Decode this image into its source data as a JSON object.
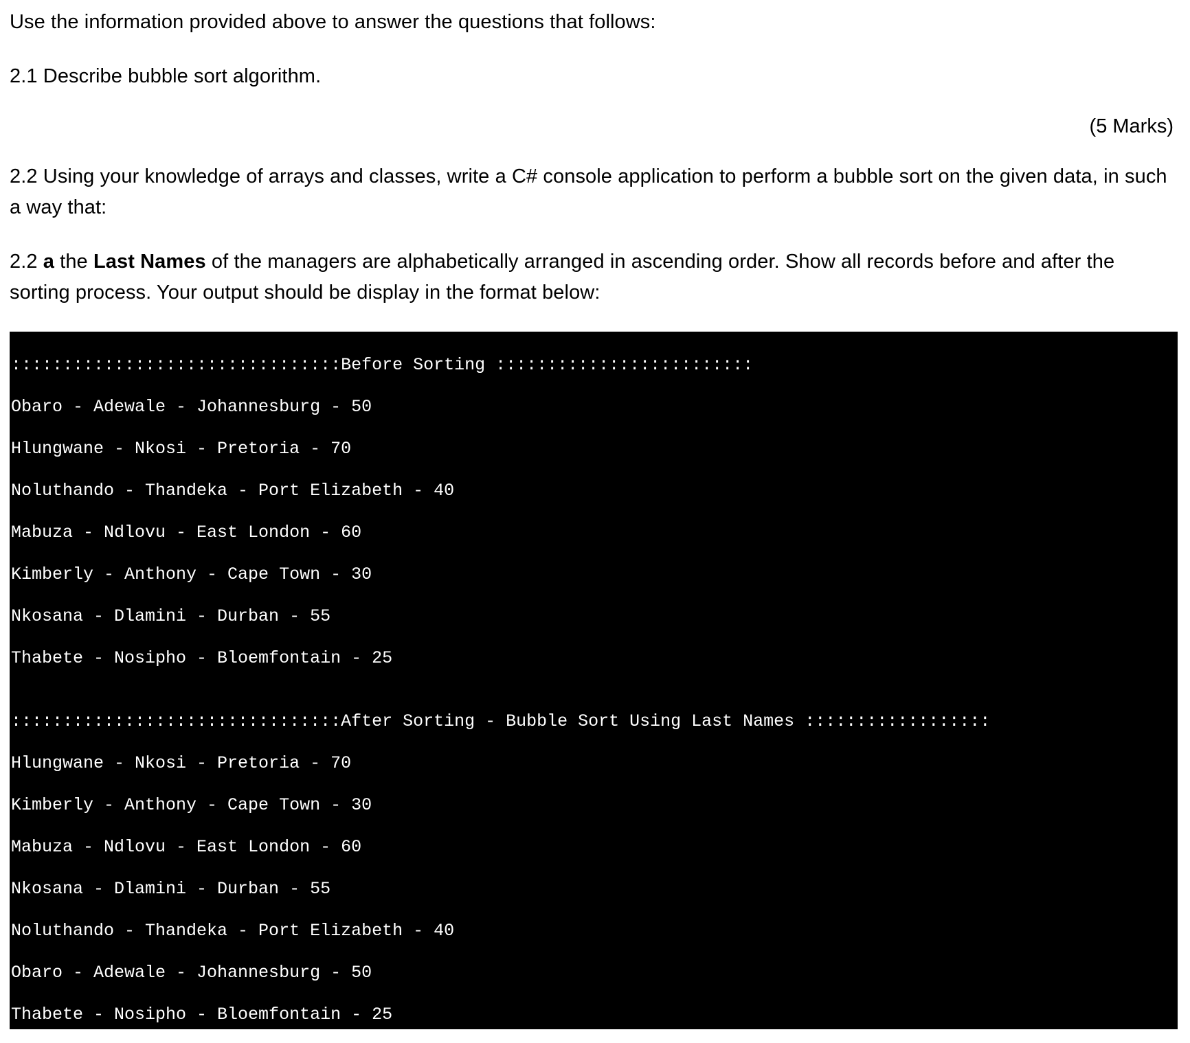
{
  "intro": "Use the information provided above to answer the questions that follows:",
  "q21": "2.1 Describe bubble sort algorithm.",
  "marks_21": "(5 Marks)",
  "q22_intro": "2.2 Using your knowledge of arrays and classes, write a C# console application to perform a bubble sort on the given data, in such a way that:",
  "q22a_prefix": "2.2 ",
  "q22a_a": "a",
  "q22a_mid1": " the ",
  "q22a_lastnames": "Last Names",
  "q22a_rest": " of the managers are alphabetically arranged in ascending order. Show all records before and after the sorting process. Your output should be display in the format below:",
  "console": {
    "header_before": "::::::::::::::::::::::::::::::::Before Sorting :::::::::::::::::::::::::",
    "before": [
      "Obaro - Adewale - Johannesburg - 50",
      "Hlungwane - Nkosi - Pretoria - 70",
      "Noluthando - Thandeka - Port Elizabeth - 40",
      "Mabuza - Ndlovu - East London - 60",
      "Kimberly - Anthony - Cape Town - 30",
      "Nkosana - Dlamini - Durban - 55",
      "Thabete - Nosipho - Bloemfontain - 25"
    ],
    "blank": "",
    "header_after": "::::::::::::::::::::::::::::::::After Sorting - Bubble Sort Using Last Names ::::::::::::::::::",
    "after": [
      "Hlungwane - Nkosi - Pretoria - 70",
      "Kimberly - Anthony - Cape Town - 30",
      "Mabuza - Ndlovu - East London - 60",
      "Nkosana - Dlamini - Durban - 55",
      "Noluthando - Thandeka - Port Elizabeth - 40",
      "Obaro - Adewale - Johannesburg - 50",
      "Thabete - Nosipho - Bloemfontain - 25"
    ]
  }
}
